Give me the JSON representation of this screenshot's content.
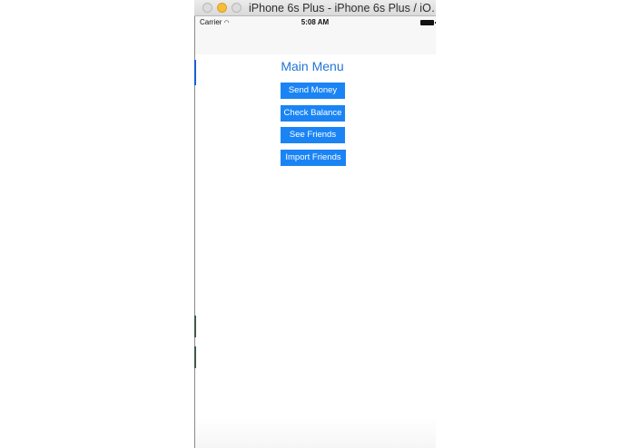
{
  "window": {
    "title": "iPhone 6s Plus - iPhone 6s Plus / iO…"
  },
  "statusbar": {
    "carrier": "Carrier",
    "wifi_icon": "wifi-icon",
    "time": "5:08 AM",
    "battery_icon": "battery-icon"
  },
  "main": {
    "title": "Main Menu",
    "buttons": [
      {
        "label": "Send Money"
      },
      {
        "label": "Check Balance"
      },
      {
        "label": "See Friends"
      },
      {
        "label": "Import Friends"
      }
    ]
  },
  "colors": {
    "accent": "#1b84f5",
    "title": "#2374d8"
  }
}
